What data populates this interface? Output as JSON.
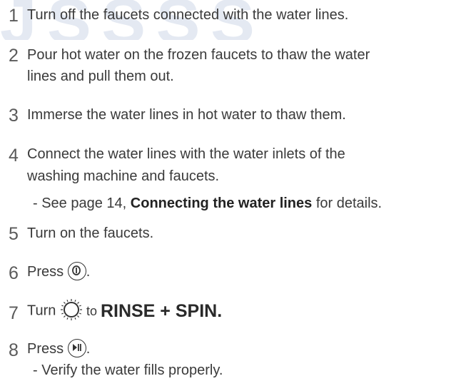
{
  "watermark": "JSSSS",
  "steps": [
    {
      "num": "1",
      "text": "Turn off the faucets connected with the water lines."
    },
    {
      "num": "2",
      "line1": "Pour hot water on the frozen faucets to thaw the water",
      "line2": "lines and pull them out."
    },
    {
      "num": "3",
      "text": "Immerse the water lines in hot water to thaw them."
    },
    {
      "num": "4",
      "line1": "Connect the water lines with the water inlets of the",
      "line2": "washing machine and faucets.",
      "note_prefix": "- See page 14, ",
      "note_bold": "Connecting the water lines",
      "note_suffix": " for details."
    },
    {
      "num": "5",
      "text": "Turn on the faucets."
    },
    {
      "num": "6",
      "prefix": "Press ",
      "suffix": ".",
      "icon": "power-icon"
    },
    {
      "num": "7",
      "prefix": "Turn ",
      "mid": " to ",
      "big": "RINSE + SPIN.",
      "icon": "program-dial-icon"
    },
    {
      "num": "8",
      "prefix": "Press ",
      "suffix": ".",
      "icon": "start-pause-icon",
      "note": "- Verify the water fills properly."
    }
  ]
}
